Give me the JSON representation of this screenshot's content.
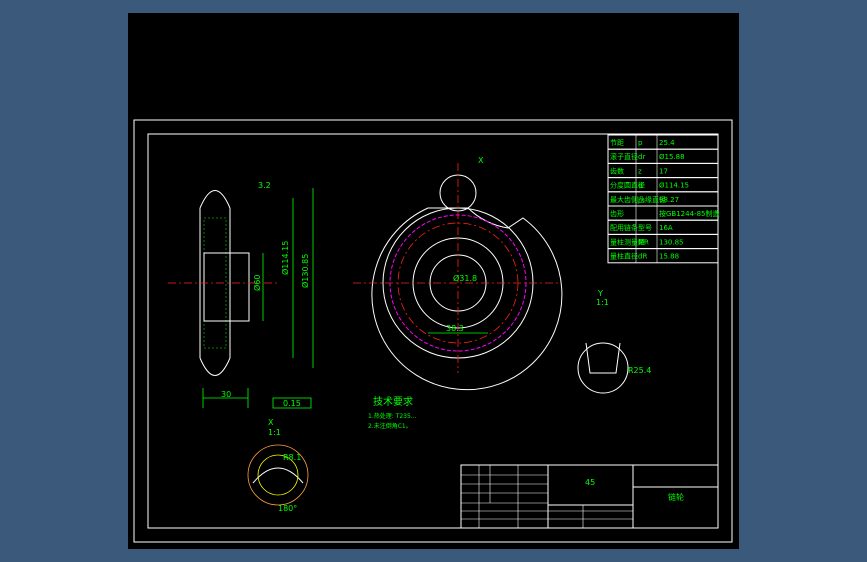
{
  "params_table": [
    {
      "name": "节距",
      "symbol": "p",
      "value": "25.4"
    },
    {
      "name": "滚子直径",
      "symbol": "dr",
      "value": "Ø15.88"
    },
    {
      "name": "齿数",
      "symbol": "z",
      "value": "17"
    },
    {
      "name": "分度圆直径",
      "symbol": "d",
      "value": "Ø114.15"
    },
    {
      "name": "最大齿侧凸缘直径",
      "symbol": "Jx",
      "value": "98.27"
    },
    {
      "name": "齿形",
      "symbol": "",
      "value": "按GB1244-85制造"
    },
    {
      "name": "配用链条型号",
      "symbol": "",
      "value": "16A"
    },
    {
      "name": "量柱测量距",
      "symbol": "MR",
      "value": "130.85"
    },
    {
      "name": "量柱直径",
      "symbol": "dR",
      "value": "15.88"
    }
  ],
  "tech_req": {
    "title": "技术要求",
    "items": [
      "1.热处理: T235...",
      "2.未注倒角C1。"
    ]
  },
  "title_block": {
    "material": "45",
    "part_name": "链轮"
  },
  "detail_views": {
    "x_label": "X",
    "x_scale": "1:1",
    "y_label": "Y",
    "y_scale": "1:1"
  },
  "dims": {
    "d1": "Ø114.15",
    "d2": "Ø130.85",
    "tol": "0.15",
    "roughness": "3.2",
    "width": "30",
    "hub": "Ø60",
    "angle": "180°",
    "r": "R8.1",
    "r2": "R25.4",
    "keyway": "38.3",
    "bore": "Ø31.8"
  },
  "colors": {
    "background": "#000000",
    "outline": "#ffffff",
    "dimension": "#00ff00",
    "centerline": "#ff2020",
    "pitch": "#ff00ff"
  }
}
